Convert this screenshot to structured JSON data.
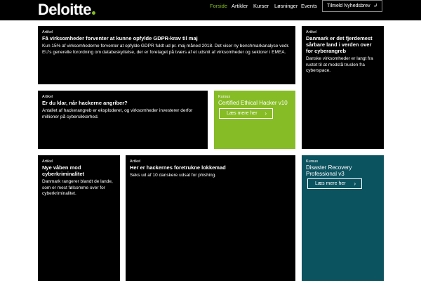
{
  "header": {
    "logo_text": "Deloitte",
    "nav": [
      "Forside",
      "Artikler",
      "Kurser",
      "Løsninger",
      "Events"
    ],
    "newsletter_label": "Tilmeld Nyhedsbrev",
    "newsletter_arrow": "↲"
  },
  "cards": [
    {
      "kicker": "Artikel",
      "title": "Få virksomheder forventer at kunne opfylde GDPR-krav til maj",
      "body": "Kun 15% af virksomhederne forventer at opfylde GDPR fuldt ud pr. maj måned 2018. Det viser ny benchmarkanalyse vedr. EU's generelle forordning om databeskyttelse, der er foretaget på tværs af et udsnit af virksomheder og sektorer i EMEA."
    },
    {
      "kicker": "Artikel",
      "title": "Danmark er det fjerdemest sårbare land i verden over for cyberangreb",
      "body": "Danske virksomheder er langt fra rustet til at modstå truslen fra cyberspace."
    },
    {
      "kicker": "Artikel",
      "title": "Er du klar, når hackerne angriber?",
      "body": "Antallet af hackerangreb er eksploderet, og virksomheder investerer derfor millioner på cybersikkerhed."
    },
    {
      "kicker": "Kursus",
      "title": "Certified Ethical Hacker v10",
      "cta": "Læs mere her"
    },
    {
      "kicker": "Artikel",
      "title": "Nye våben mod cyberkriminalitet",
      "body": "Danmark rangerer blandt de lande, som er mest følsomme over for cyberkriminalitet."
    },
    {
      "kicker": "Artikel",
      "title": "Her er hackernes foretrukne lokkemad",
      "body": "Seks ud af 10 danskere udsat for phishing."
    },
    {
      "kicker": "Kursus",
      "title": "Disaster Recovery Professional v3",
      "cta": "Læs mere her"
    }
  ],
  "chevron": "›",
  "colors": {
    "brand_green": "#86bc25",
    "teal": "#0c5360",
    "black": "#000000"
  }
}
